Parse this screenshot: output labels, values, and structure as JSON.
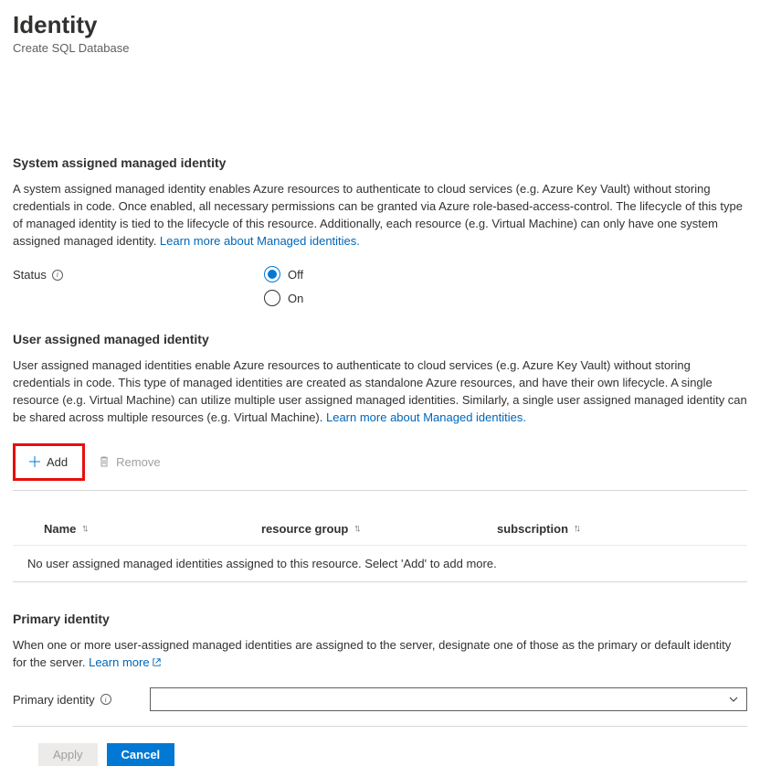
{
  "header": {
    "title": "Identity",
    "subtitle": "Create SQL Database"
  },
  "system": {
    "heading": "System assigned managed identity",
    "desc": "A system assigned managed identity enables Azure resources to authenticate to cloud services (e.g. Azure Key Vault) without storing credentials in code. Once enabled, all necessary permissions can be granted via Azure role-based-access-control. The lifecycle of this type of managed identity is tied to the lifecycle of this resource. Additionally, each resource (e.g. Virtual Machine) can only have one system assigned managed identity. ",
    "learn_more": "Learn more about Managed identities.",
    "status_label": "Status",
    "off_label": "Off",
    "on_label": "On",
    "selected": "off"
  },
  "user": {
    "heading": "User assigned managed identity",
    "desc": "User assigned managed identities enable Azure resources to authenticate to cloud services (e.g. Azure Key Vault) without storing credentials in code. This type of managed identities are created as standalone Azure resources, and have their own lifecycle. A single resource (e.g. Virtual Machine) can utilize multiple user assigned managed identities. Similarly, a single user assigned managed identity can be shared across multiple resources (e.g. Virtual Machine). ",
    "learn_more": "Learn more about Managed identities.",
    "add_label": "Add",
    "remove_label": "Remove",
    "columns": {
      "name": "Name",
      "rg": "resource group",
      "sub": "subscription"
    },
    "empty": "No user assigned managed identities assigned to this resource. Select 'Add' to add more."
  },
  "primary": {
    "heading": "Primary identity",
    "desc": "When one or more user-assigned managed identities are assigned to the server, designate one of those as the primary or default identity for the server. ",
    "learn_more": "Learn more",
    "field_label": "Primary identity"
  },
  "footer": {
    "apply": "Apply",
    "cancel": "Cancel"
  }
}
